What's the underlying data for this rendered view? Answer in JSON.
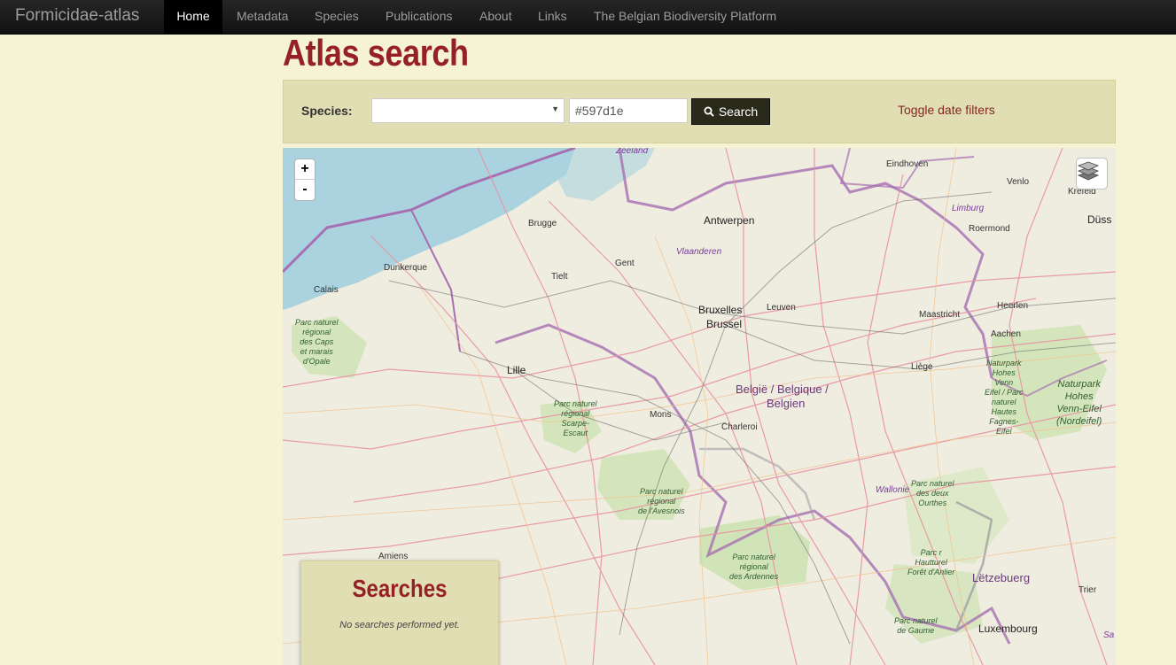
{
  "navbar": {
    "brand": "Formicidae-atlas",
    "items": [
      {
        "label": "Home",
        "active": true
      },
      {
        "label": "Metadata"
      },
      {
        "label": "Species"
      },
      {
        "label": "Publications"
      },
      {
        "label": "About"
      },
      {
        "label": "Links"
      },
      {
        "label": "The Belgian Biodiversity Platform"
      }
    ]
  },
  "page": {
    "title": "Atlas search"
  },
  "search": {
    "species_label": "Species:",
    "species_value": "",
    "color_value": "#597d1e",
    "button_label": "Search",
    "toggle_label": "Toggle date filters"
  },
  "map": {
    "zoom_in": "+",
    "zoom_out": "-",
    "labels": {
      "zeeland": "Zeeland",
      "eindhoven": "Eindhoven",
      "venlo": "Venlo",
      "krefeld": "Krefeld",
      "dusseldorf": "Düss",
      "limburg": "Limburg",
      "roermond": "Roermond",
      "antwerpen": "Antwerpen",
      "brugge": "Brugge",
      "vlaanderen": "Vlaanderen",
      "gent": "Gent",
      "dunkerque": "Dunkerque",
      "tielt": "Tielt",
      "calais": "Calais",
      "bruxelles": "Bruxelles",
      "brussel": "Brussel",
      "leuven": "Leuven",
      "maastricht": "Maastricht",
      "heerlen": "Heerlen",
      "aachen": "Aachen",
      "lille": "Lille",
      "liege": "Liège",
      "belgie1": "België / Belgique /",
      "belgie2": "Belgien",
      "mons": "Mons",
      "charleroi": "Charleroi",
      "wallonie": "Wallonie",
      "amiens": "Amiens",
      "letzebuerg": "Lëtzebuerg",
      "trier": "Trier",
      "luxembourg": "Luxembourg",
      "sa": "Sa",
      "park_caps": "Parc naturel\nrégional\ndes Caps\net marais\nd'Opale",
      "park_scarpe": "Parc naturel\nrégional\nScarpe-\nEscaut",
      "park_avesnois": "Parc naturel\nrégional\nde l'Avesnois",
      "park_ardennes": "Parc naturel\nrégional\ndes Ardennes",
      "park_hohes1": "Naturpark\nHohes\nVenn\nEifel / Parc\nnaturel\nHautes\nFagnes-\nEifel",
      "park_hohes2": "Naturpark\nHohes\nVenn-Eifel\n(Nordeifel)",
      "park_ourthes": "Parc naturel\ndes deux\nOurthes",
      "park_haut": "Parc r\nHautturel\nForêt d'Anlier",
      "park_gaume": "Parc naturel\nde Gaume"
    },
    "searches_title": "Searches",
    "searches_empty": "No searches performed yet."
  },
  "colors": {
    "accent": "#952026",
    "panel": "#e1deb4",
    "page_bg": "#f5f3d4",
    "navbar": "#1b1b1b"
  }
}
